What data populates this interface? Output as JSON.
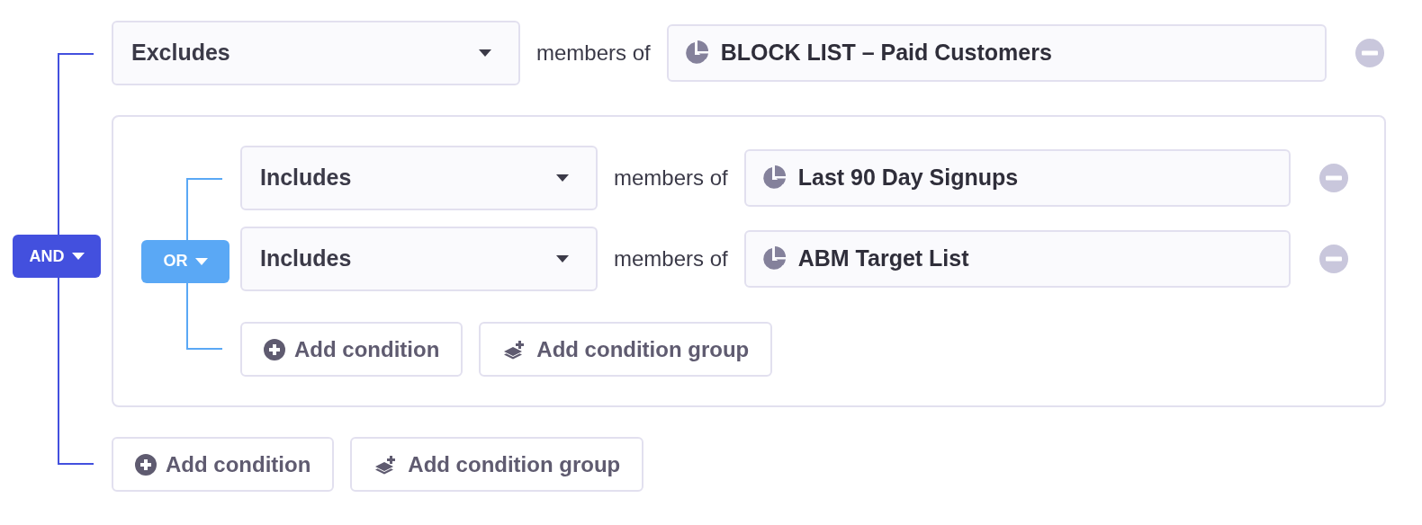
{
  "root_group": {
    "operator": {
      "label": "AND",
      "color": "#4350de"
    },
    "items": [
      {
        "kind": "condition",
        "mode": "Excludes",
        "connector": "members of",
        "segment": "BLOCK LIST – Paid Customers"
      },
      {
        "kind": "group",
        "operator": {
          "label": "OR",
          "color": "#5aa8f5"
        },
        "items": [
          {
            "kind": "condition",
            "mode": "Includes",
            "connector": "members of",
            "segment": "Last 90 Day Signups"
          },
          {
            "kind": "condition",
            "mode": "Includes",
            "connector": "members of",
            "segment": "ABM Target List"
          }
        ],
        "actions": [
          {
            "kind": "condition",
            "label": "Add condition"
          },
          {
            "kind": "group",
            "label": "Add condition group"
          }
        ]
      }
    ],
    "actions": [
      {
        "kind": "condition",
        "label": "Add condition"
      },
      {
        "kind": "group",
        "label": "Add condition group"
      }
    ]
  }
}
